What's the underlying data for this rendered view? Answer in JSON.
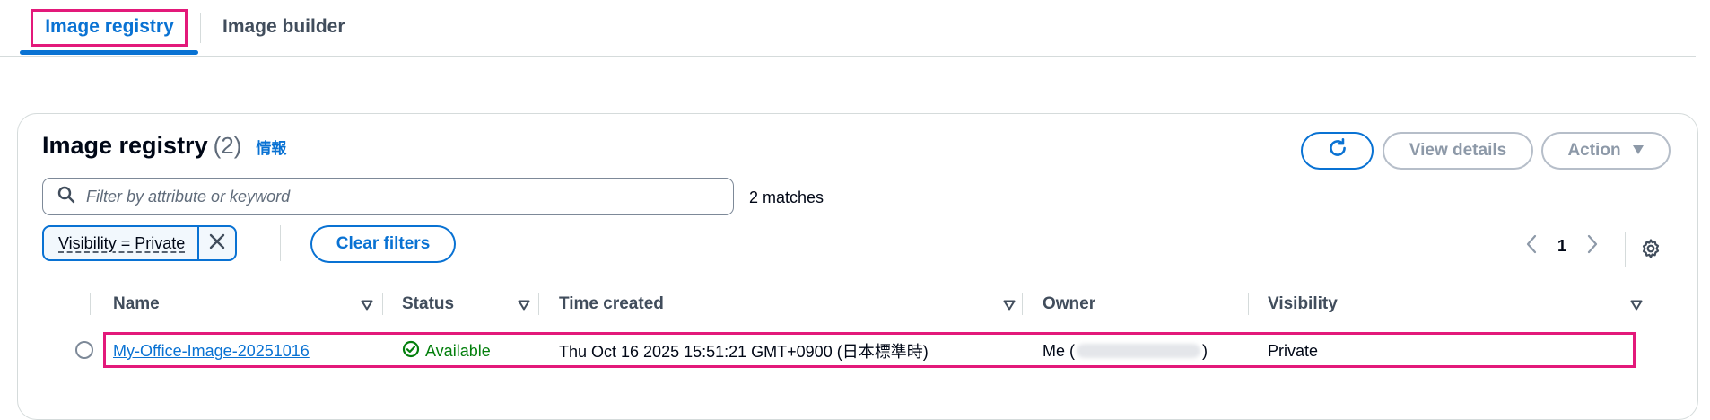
{
  "tabs": [
    {
      "label": "Image registry",
      "active": true
    },
    {
      "label": "Image builder",
      "active": false
    }
  ],
  "header": {
    "title": "Image registry",
    "count": "(2)",
    "info": "情報"
  },
  "actions": {
    "view_details": "View details",
    "action": "Action"
  },
  "search": {
    "placeholder": "Filter by attribute or keyword",
    "matches": "2 matches"
  },
  "filter_token": {
    "label": "Visibility = Private"
  },
  "clear_filters": "Clear filters",
  "pagination": {
    "current_page": "1"
  },
  "table": {
    "columns": [
      "Name",
      "Status",
      "Time created",
      "Owner",
      "Visibility"
    ],
    "rows": [
      {
        "name": "My-Office-Image-20251016",
        "status": "Available",
        "time_created": "Thu Oct 16 2025 15:51:21 GMT+0900 (日本標準時)",
        "owner_prefix": "Me (",
        "owner_suffix": ")",
        "visibility": "Private"
      }
    ]
  },
  "colors": {
    "accent": "#0972d3",
    "success": "#037f0c",
    "highlight": "#e3197a"
  },
  "icons": [
    "refresh-icon",
    "caret-down-icon",
    "search-icon",
    "close-icon",
    "chevron-left-icon",
    "chevron-right-icon",
    "settings-icon",
    "sort-icon",
    "check-circle-icon"
  ]
}
